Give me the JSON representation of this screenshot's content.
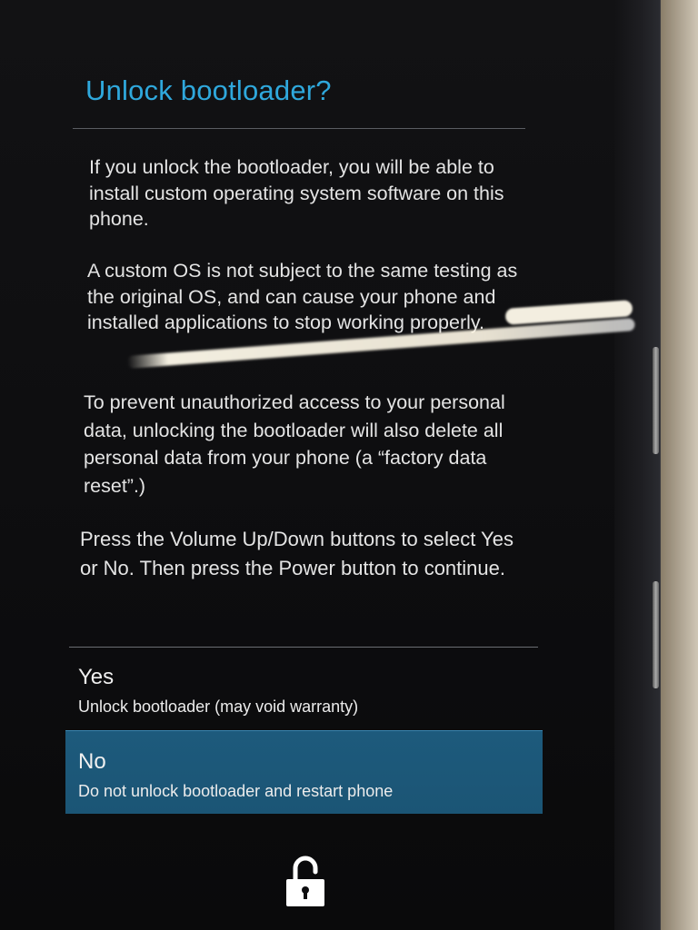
{
  "dialog": {
    "title": "Unlock bootloader?",
    "paragraphs": [
      "If you unlock the bootloader, you will be able to install custom operating system software on this phone.",
      "A custom OS is not subject to the same testing as the original OS, and can cause your phone and installed applications to stop working properly.",
      "To prevent unauthorized access to your personal data, unlocking the bootloader will also delete all personal data from your phone (a “factory data reset”.)",
      "Press the Volume Up/Down buttons to select Yes or No. Then press the Power button to continue."
    ]
  },
  "options": [
    {
      "label": "Yes",
      "description": "Unlock bootloader (may void warranty)",
      "selected": false
    },
    {
      "label": "No",
      "description": "Do not unlock bootloader and restart phone",
      "selected": true
    }
  ],
  "icons": {
    "footer": "unlocked-padlock-icon"
  },
  "colors": {
    "title": "#2fa8dc",
    "selection": "#1d5a7c",
    "background": "#0d0d0f"
  }
}
